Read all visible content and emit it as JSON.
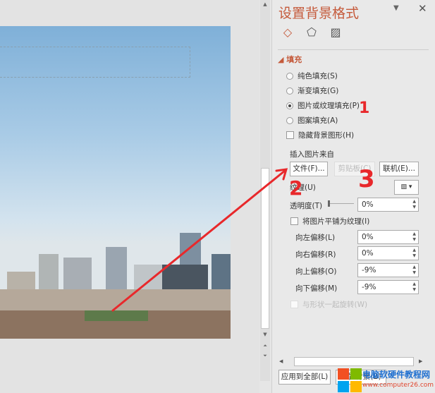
{
  "panel": {
    "title": "设置背景格式",
    "tabs": [
      "fill",
      "effects",
      "picture"
    ],
    "section": "填充",
    "fill_options": [
      {
        "label": "纯色填充(S)",
        "selected": false
      },
      {
        "label": "渐变填充(G)",
        "selected": false
      },
      {
        "label": "图片或纹理填充(P)",
        "selected": true
      },
      {
        "label": "图案填充(A)",
        "selected": false
      }
    ],
    "hide_bg": "隐藏背景图形(H)",
    "insert_from": "插入图片来自",
    "btn_file": "文件(F)...",
    "btn_clipboard": "剪贴板(C)",
    "btn_online": "联机(E)...",
    "texture": "纹理(U)",
    "transparency_label": "透明度(T)",
    "transparency_value": "0%",
    "tile": "将图片平铺为纹理(I)",
    "offsets": [
      {
        "label": "向左偏移(L)",
        "value": "0%"
      },
      {
        "label": "向右偏移(R)",
        "value": "0%"
      },
      {
        "label": "向上偏移(O)",
        "value": "-9%"
      },
      {
        "label": "向下偏移(M)",
        "value": "-9%"
      }
    ],
    "rotate": "与形状一起旋转(W)",
    "apply_all": "应用到全部(L)",
    "reset": "重置背景(B)"
  },
  "annotations": [
    "1",
    "2",
    "3"
  ],
  "watermark": {
    "line1": "电脑软硬件教程网",
    "line2": "www.computer26.com"
  }
}
